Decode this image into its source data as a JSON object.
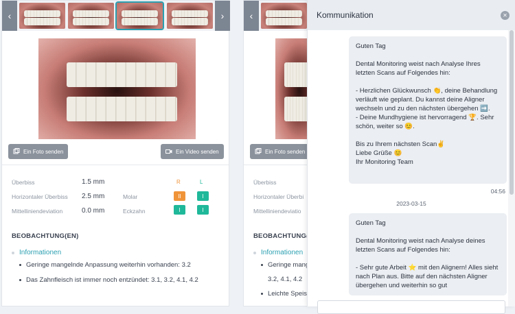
{
  "card1": {
    "send_photo": "Ein Foto senden",
    "send_video": "Ein Video senden",
    "col_r": "R",
    "col_l": "L",
    "measurements": [
      {
        "label": "Überbiss",
        "value": "1.5 mm"
      },
      {
        "label": "Horizontaler Überbiss",
        "value": "2.5 mm"
      },
      {
        "label": "Mittelliniendeviation",
        "value": "0.0 mm"
      }
    ],
    "classes": [
      {
        "label": "Molar",
        "r": "II",
        "l": "I"
      },
      {
        "label": "Eckzahn",
        "r": "I",
        "l": "I"
      }
    ],
    "section_title": "BEOBACHTUNG(EN)",
    "info_head": "Informationen",
    "bullets": [
      "Geringe mangelnde Anpassung weiterhin vorhanden: 3.2",
      "Das Zahnfleisch ist immer noch entzündet: 3.1, 3.2, 4.1, 4.2"
    ]
  },
  "card2": {
    "send_photo": "Ein Foto senden",
    "measurements": [
      "Überbiss",
      "Horizontaler Überbi",
      "Mittelliniendeviatio"
    ],
    "section_title": "BEOBACHTUNG(EN)",
    "info_head": "Informationen",
    "bullet1": "Geringe mangel",
    "bullet1_cont": "3.2, 4.1, 4.2",
    "bullet2": "Leichte Speis"
  },
  "panel": {
    "title": "Kommunikation",
    "msg1": "Guten Tag\n\nDental Monitoring weist nach Analyse Ihres letzten Scans auf Folgendes hin:\n\n- Herzlichen Glückwunsch 👏, deine Behandlung verläuft wie geplant. Du kannst deine Aligner wechseln und zu den nächsten übergehen ➡️.\n- Deine Mundhygiene ist hervorragend 🏆. Sehr schön, weiter so 😊.\n\nBis zu Ihrem nächsten Scan✌️\nLiebe Grüße 😊\nIhr Monitoring Team",
    "time1": "04:56",
    "date2": "2023-03-15",
    "msg2": "Guten Tag\n\nDental Monitoring weist nach Analyse deines letzten Scans auf Folgendes hin:\n\n- Sehr gute Arbeit ⭐ mit den Alignern! Alles sieht nach Plan aus. Bitte auf den nächsten Aligner übergehen und weiterhin so gut"
  },
  "colors": {
    "accent": "#2a9fb1",
    "orange": "#f0943a",
    "green": "#1fb89a",
    "button": "#8b929c"
  }
}
